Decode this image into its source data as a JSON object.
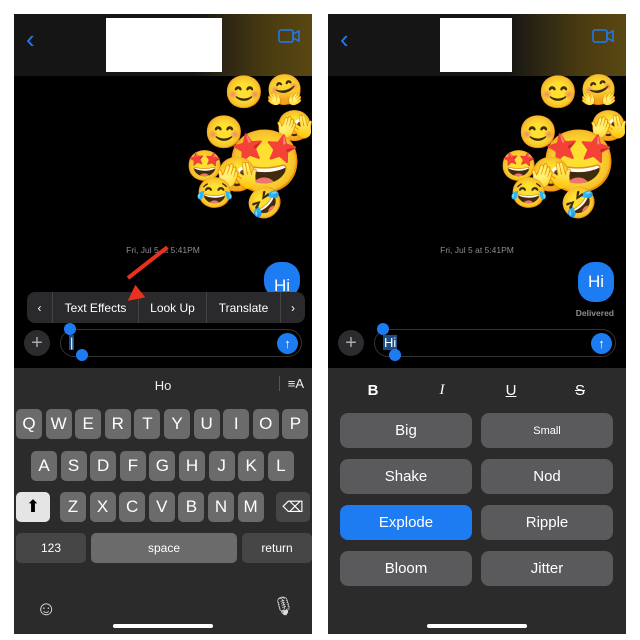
{
  "left": {
    "timestamp": "Fri, Jul 5 at 5:41PM",
    "bubble": "Hi",
    "menu": {
      "prev": "‹",
      "items": [
        "Text Effects",
        "Look Up",
        "Translate"
      ],
      "next": "›"
    },
    "input_text": "|",
    "suggestion": "Ho",
    "format_icon": "≡A",
    "keys": {
      "row1": [
        "Q",
        "W",
        "E",
        "R",
        "T",
        "Y",
        "U",
        "I",
        "O",
        "P"
      ],
      "row2": [
        "A",
        "S",
        "D",
        "F",
        "G",
        "H",
        "J",
        "K",
        "L"
      ],
      "row3": [
        "Z",
        "X",
        "C",
        "V",
        "B",
        "N",
        "M"
      ],
      "numbers": "123",
      "space": "space",
      "return": "return"
    },
    "annotation_color": "#e8321e"
  },
  "right": {
    "timestamp": "Fri, Jul 5 at 5:41PM",
    "bubble": "Hi",
    "status": "Delivered",
    "input_text": "Hi",
    "format": [
      "B",
      "I",
      "U",
      "S"
    ],
    "effects": [
      "Big",
      "Small",
      "Shake",
      "Nod",
      "Explode",
      "Ripple",
      "Bloom",
      "Jitter"
    ],
    "selected_effect": "Explode"
  },
  "emojis": [
    "😊",
    "🤗",
    "😊",
    "🫣",
    "🤩",
    "🤩",
    "🫣",
    "😂",
    "🤣"
  ],
  "colors": {
    "accent": "#1e7cf2",
    "background": "#000000",
    "keyboard": "#2b2b2b"
  }
}
